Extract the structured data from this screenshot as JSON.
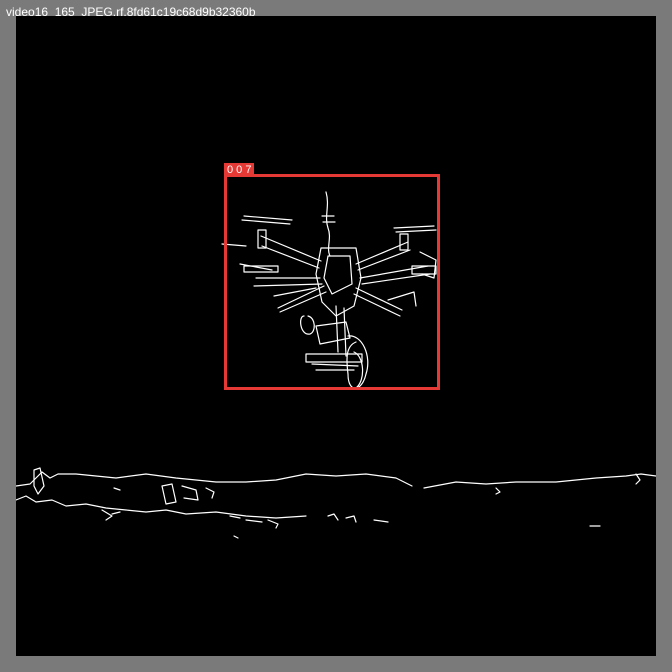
{
  "image": {
    "filename": "video16_165_JPEG.rf.8fd61c19c68d9b32360b"
  },
  "detection": {
    "label": "0 0 7"
  },
  "colors": {
    "frame": "#7a7a7a",
    "canvas": "#000000",
    "edges": "#ffffff",
    "bbox": "#e53935"
  }
}
